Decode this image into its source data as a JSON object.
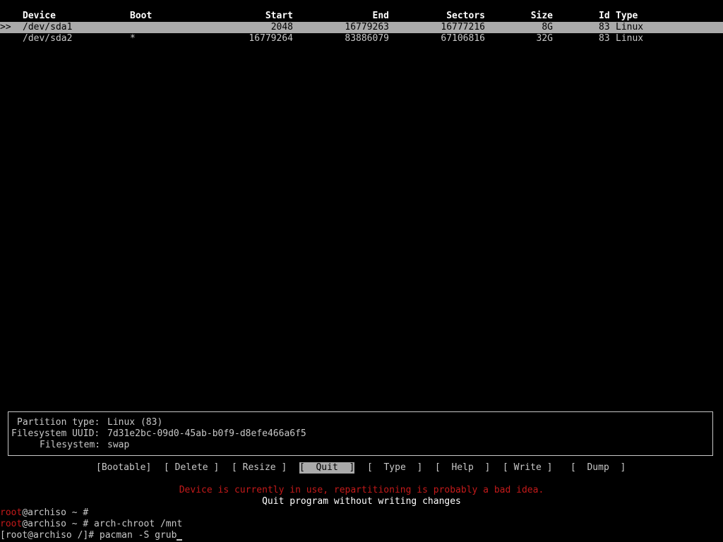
{
  "table": {
    "columns": {
      "device": "Device",
      "boot": "Boot",
      "start": "Start",
      "end": "End",
      "sectors": "Sectors",
      "size": "Size",
      "id": "Id",
      "type": "Type"
    },
    "selection_marker": ">>",
    "rows": [
      {
        "device": "/dev/sda1",
        "boot": "",
        "start": "2048",
        "end": "16779263",
        "sectors": "16777216",
        "size": "8G",
        "id": "83",
        "type": "Linux"
      },
      {
        "device": "/dev/sda2",
        "boot": "*",
        "start": "16779264",
        "end": "83886079",
        "sectors": "67106816",
        "size": "32G",
        "id": "83",
        "type": "Linux"
      }
    ]
  },
  "info": {
    "partition_type_label": "Partition type:",
    "partition_type_value": "Linux (83)",
    "uuid_label": "Filesystem UUID:",
    "uuid_value": "7d31e2bc-09d0-45ab-b0f9-d8efe466a6f5",
    "fs_label": "Filesystem:",
    "fs_value": "swap"
  },
  "menu": {
    "bootable": "[Bootable]",
    "delete": "[ Delete ]",
    "resize": "[ Resize ]",
    "quit": "[  Quit  ]",
    "type": "[  Type  ]",
    "help": "[  Help  ]",
    "write": "[ Write ]",
    "dump": "[  Dump  ]"
  },
  "status": {
    "warning": "Device is currently in use, repartitioning is probably a bad idea.",
    "hint": "Quit program without writing changes"
  },
  "terminal": {
    "line1_user": "root",
    "line1_rest": "@archiso ~ #",
    "line2_user": "root",
    "line2_rest": "@archiso ~ # arch-chroot /mnt",
    "line3": "[root@archiso /]# pacman -S grub"
  },
  "colors": {
    "background": "#000000",
    "foreground": "#c8c8c8",
    "selection": "#aaaaaa",
    "warning": "#c41a1a"
  }
}
